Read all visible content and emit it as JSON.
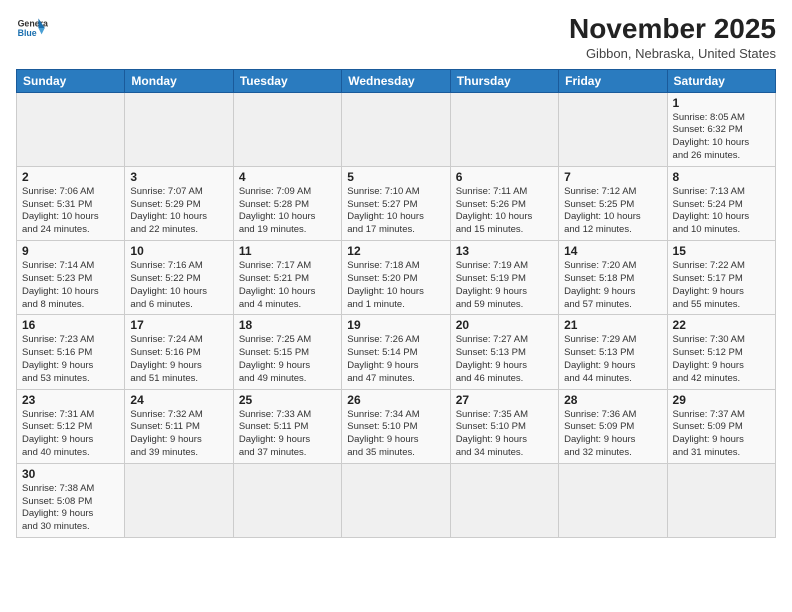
{
  "header": {
    "logo_general": "General",
    "logo_blue": "Blue",
    "month_title": "November 2025",
    "location": "Gibbon, Nebraska, United States"
  },
  "weekdays": [
    "Sunday",
    "Monday",
    "Tuesday",
    "Wednesday",
    "Thursday",
    "Friday",
    "Saturday"
  ],
  "weeks": [
    [
      {
        "day": "",
        "info": ""
      },
      {
        "day": "",
        "info": ""
      },
      {
        "day": "",
        "info": ""
      },
      {
        "day": "",
        "info": ""
      },
      {
        "day": "",
        "info": ""
      },
      {
        "day": "",
        "info": ""
      },
      {
        "day": "1",
        "info": "Sunrise: 8:05 AM\nSunset: 6:32 PM\nDaylight: 10 hours\nand 26 minutes."
      }
    ],
    [
      {
        "day": "2",
        "info": "Sunrise: 7:06 AM\nSunset: 5:31 PM\nDaylight: 10 hours\nand 24 minutes."
      },
      {
        "day": "3",
        "info": "Sunrise: 7:07 AM\nSunset: 5:29 PM\nDaylight: 10 hours\nand 22 minutes."
      },
      {
        "day": "4",
        "info": "Sunrise: 7:09 AM\nSunset: 5:28 PM\nDaylight: 10 hours\nand 19 minutes."
      },
      {
        "day": "5",
        "info": "Sunrise: 7:10 AM\nSunset: 5:27 PM\nDaylight: 10 hours\nand 17 minutes."
      },
      {
        "day": "6",
        "info": "Sunrise: 7:11 AM\nSunset: 5:26 PM\nDaylight: 10 hours\nand 15 minutes."
      },
      {
        "day": "7",
        "info": "Sunrise: 7:12 AM\nSunset: 5:25 PM\nDaylight: 10 hours\nand 12 minutes."
      },
      {
        "day": "8",
        "info": "Sunrise: 7:13 AM\nSunset: 5:24 PM\nDaylight: 10 hours\nand 10 minutes."
      }
    ],
    [
      {
        "day": "9",
        "info": "Sunrise: 7:14 AM\nSunset: 5:23 PM\nDaylight: 10 hours\nand 8 minutes."
      },
      {
        "day": "10",
        "info": "Sunrise: 7:16 AM\nSunset: 5:22 PM\nDaylight: 10 hours\nand 6 minutes."
      },
      {
        "day": "11",
        "info": "Sunrise: 7:17 AM\nSunset: 5:21 PM\nDaylight: 10 hours\nand 4 minutes."
      },
      {
        "day": "12",
        "info": "Sunrise: 7:18 AM\nSunset: 5:20 PM\nDaylight: 10 hours\nand 1 minute."
      },
      {
        "day": "13",
        "info": "Sunrise: 7:19 AM\nSunset: 5:19 PM\nDaylight: 9 hours\nand 59 minutes."
      },
      {
        "day": "14",
        "info": "Sunrise: 7:20 AM\nSunset: 5:18 PM\nDaylight: 9 hours\nand 57 minutes."
      },
      {
        "day": "15",
        "info": "Sunrise: 7:22 AM\nSunset: 5:17 PM\nDaylight: 9 hours\nand 55 minutes."
      }
    ],
    [
      {
        "day": "16",
        "info": "Sunrise: 7:23 AM\nSunset: 5:16 PM\nDaylight: 9 hours\nand 53 minutes."
      },
      {
        "day": "17",
        "info": "Sunrise: 7:24 AM\nSunset: 5:16 PM\nDaylight: 9 hours\nand 51 minutes."
      },
      {
        "day": "18",
        "info": "Sunrise: 7:25 AM\nSunset: 5:15 PM\nDaylight: 9 hours\nand 49 minutes."
      },
      {
        "day": "19",
        "info": "Sunrise: 7:26 AM\nSunset: 5:14 PM\nDaylight: 9 hours\nand 47 minutes."
      },
      {
        "day": "20",
        "info": "Sunrise: 7:27 AM\nSunset: 5:13 PM\nDaylight: 9 hours\nand 46 minutes."
      },
      {
        "day": "21",
        "info": "Sunrise: 7:29 AM\nSunset: 5:13 PM\nDaylight: 9 hours\nand 44 minutes."
      },
      {
        "day": "22",
        "info": "Sunrise: 7:30 AM\nSunset: 5:12 PM\nDaylight: 9 hours\nand 42 minutes."
      }
    ],
    [
      {
        "day": "23",
        "info": "Sunrise: 7:31 AM\nSunset: 5:12 PM\nDaylight: 9 hours\nand 40 minutes."
      },
      {
        "day": "24",
        "info": "Sunrise: 7:32 AM\nSunset: 5:11 PM\nDaylight: 9 hours\nand 39 minutes."
      },
      {
        "day": "25",
        "info": "Sunrise: 7:33 AM\nSunset: 5:11 PM\nDaylight: 9 hours\nand 37 minutes."
      },
      {
        "day": "26",
        "info": "Sunrise: 7:34 AM\nSunset: 5:10 PM\nDaylight: 9 hours\nand 35 minutes."
      },
      {
        "day": "27",
        "info": "Sunrise: 7:35 AM\nSunset: 5:10 PM\nDaylight: 9 hours\nand 34 minutes."
      },
      {
        "day": "28",
        "info": "Sunrise: 7:36 AM\nSunset: 5:09 PM\nDaylight: 9 hours\nand 32 minutes."
      },
      {
        "day": "29",
        "info": "Sunrise: 7:37 AM\nSunset: 5:09 PM\nDaylight: 9 hours\nand 31 minutes."
      }
    ],
    [
      {
        "day": "30",
        "info": "Sunrise: 7:38 AM\nSunset: 5:08 PM\nDaylight: 9 hours\nand 30 minutes."
      },
      {
        "day": "",
        "info": ""
      },
      {
        "day": "",
        "info": ""
      },
      {
        "day": "",
        "info": ""
      },
      {
        "day": "",
        "info": ""
      },
      {
        "day": "",
        "info": ""
      },
      {
        "day": "",
        "info": ""
      }
    ]
  ]
}
